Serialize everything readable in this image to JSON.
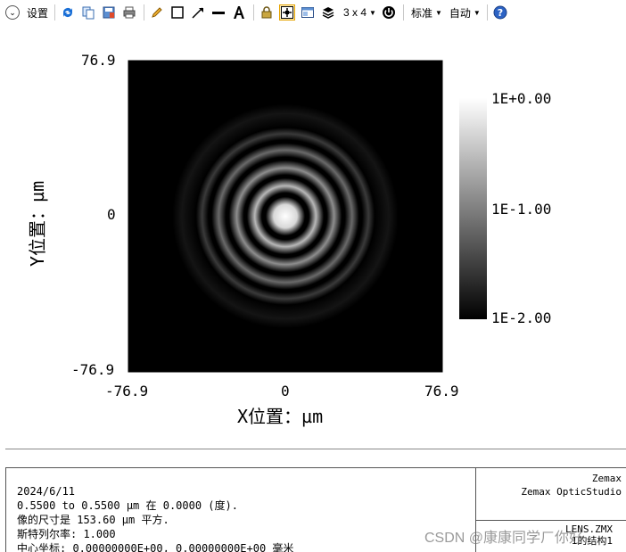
{
  "toolbar": {
    "settings_label": "设置",
    "grid_label": "3 x 4",
    "standard_label": "标准",
    "auto_label": "自动"
  },
  "plot": {
    "x_title": "X位置：µm",
    "y_title": "Y位置：µm",
    "x_ticks": [
      "-76.9",
      "0",
      "76.9"
    ],
    "y_ticks": [
      "76.9",
      "0",
      "-76.9"
    ],
    "colorbar_ticks": [
      "1E+0.00",
      "1E-1.00",
      "1E-2.00"
    ]
  },
  "chart_data": {
    "type": "heatmap",
    "description_kind": "FFT PSF",
    "xlim": [
      -76.9,
      76.9
    ],
    "ylim": [
      -76.9,
      76.9
    ],
    "x_ticks": [
      -76.9,
      0,
      76.9
    ],
    "y_ticks": [
      76.9,
      0,
      -76.9
    ],
    "xlabel": "X位置：µm",
    "ylabel": "Y位置：µm",
    "colorbar": {
      "scale": "log",
      "min": 0.01,
      "max": 1.0,
      "labels": [
        "1E+0.00",
        "1E-1.00",
        "1E-2.00"
      ]
    },
    "colors": {
      "high": "#ffffff",
      "low": "#000000"
    }
  },
  "info": {
    "lines": [
      "2024/6/11",
      "0.5500 to 0.5500 µm 在 0.0000 (度).",
      "像的尺寸是 153.60 µm 平方.",
      "斯特列尔率: 1.000",
      "中心坐标:    0.00000000E+00,   0.00000000E+00 毫米"
    ],
    "brand_1": "Zemax",
    "brand_2": "Zemax OpticStudio",
    "file": "LENS.ZMX",
    "config": "1的结构1"
  },
  "watermark": "CSDN @康康同学ㄏ你好"
}
